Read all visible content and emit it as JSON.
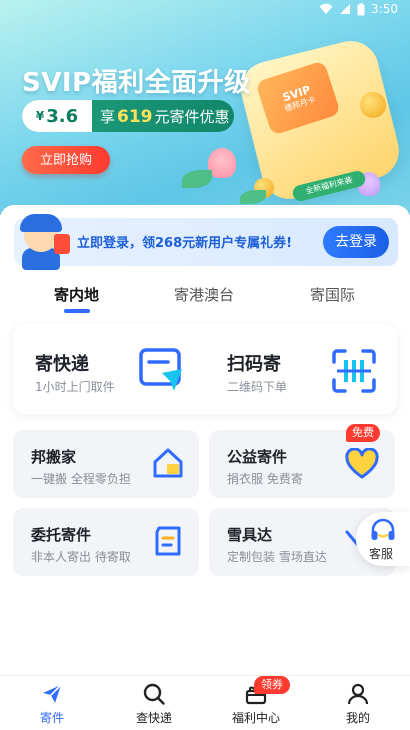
{
  "status_bar": {
    "time": "3:50"
  },
  "hero": {
    "title": "SVIP福利全面升级",
    "price_symbol": "¥",
    "price": "3.6",
    "offer_prefix": "享",
    "offer_amount": "619",
    "offer_suffix": "元寄件优惠",
    "buy_button": "立即抢购",
    "vip_card_title": "SVIP",
    "vip_card_sub": "德邦月卡",
    "strip_text": "全新福利来袭"
  },
  "login_banner": {
    "text": "立即登录，领268元新用户专属礼券!",
    "button": "去登录"
  },
  "tabs": [
    {
      "label": "寄内地",
      "active": true
    },
    {
      "label": "寄港澳台",
      "active": false
    },
    {
      "label": "寄国际",
      "active": false
    }
  ],
  "main_services": [
    {
      "title": "寄快递",
      "subtitle": "1小时上门取件",
      "icon": "send-icon"
    },
    {
      "title": "扫码寄",
      "subtitle": "二维码下单",
      "icon": "scan-icon"
    }
  ],
  "sub_services": [
    {
      "title": "邦搬家",
      "subtitle": "一键搬 全程零负担",
      "icon": "house-icon"
    },
    {
      "title": "公益寄件",
      "subtitle": "捐衣服 免费寄",
      "icon": "heart-icon",
      "badge": "免费"
    },
    {
      "title": "委托寄件",
      "subtitle": "非本人寄出 待寄取",
      "icon": "document-icon"
    },
    {
      "title": "雪具达",
      "subtitle": "定制包装 雪场直达",
      "icon": "ski-icon"
    }
  ],
  "customer_service": {
    "label": "客服",
    "icon": "headset-icon"
  },
  "bottom_nav": [
    {
      "label": "寄件",
      "icon": "send-plane-icon",
      "active": true
    },
    {
      "label": "查快递",
      "icon": "search-icon",
      "active": false
    },
    {
      "label": "福利中心",
      "icon": "gift-icon",
      "active": false,
      "badge": "领券"
    },
    {
      "label": "我的",
      "icon": "person-icon",
      "active": false
    }
  ],
  "colors": {
    "primary": "#2f6bff",
    "accent_red": "#ff3b30",
    "hero_green": "#12876a"
  }
}
